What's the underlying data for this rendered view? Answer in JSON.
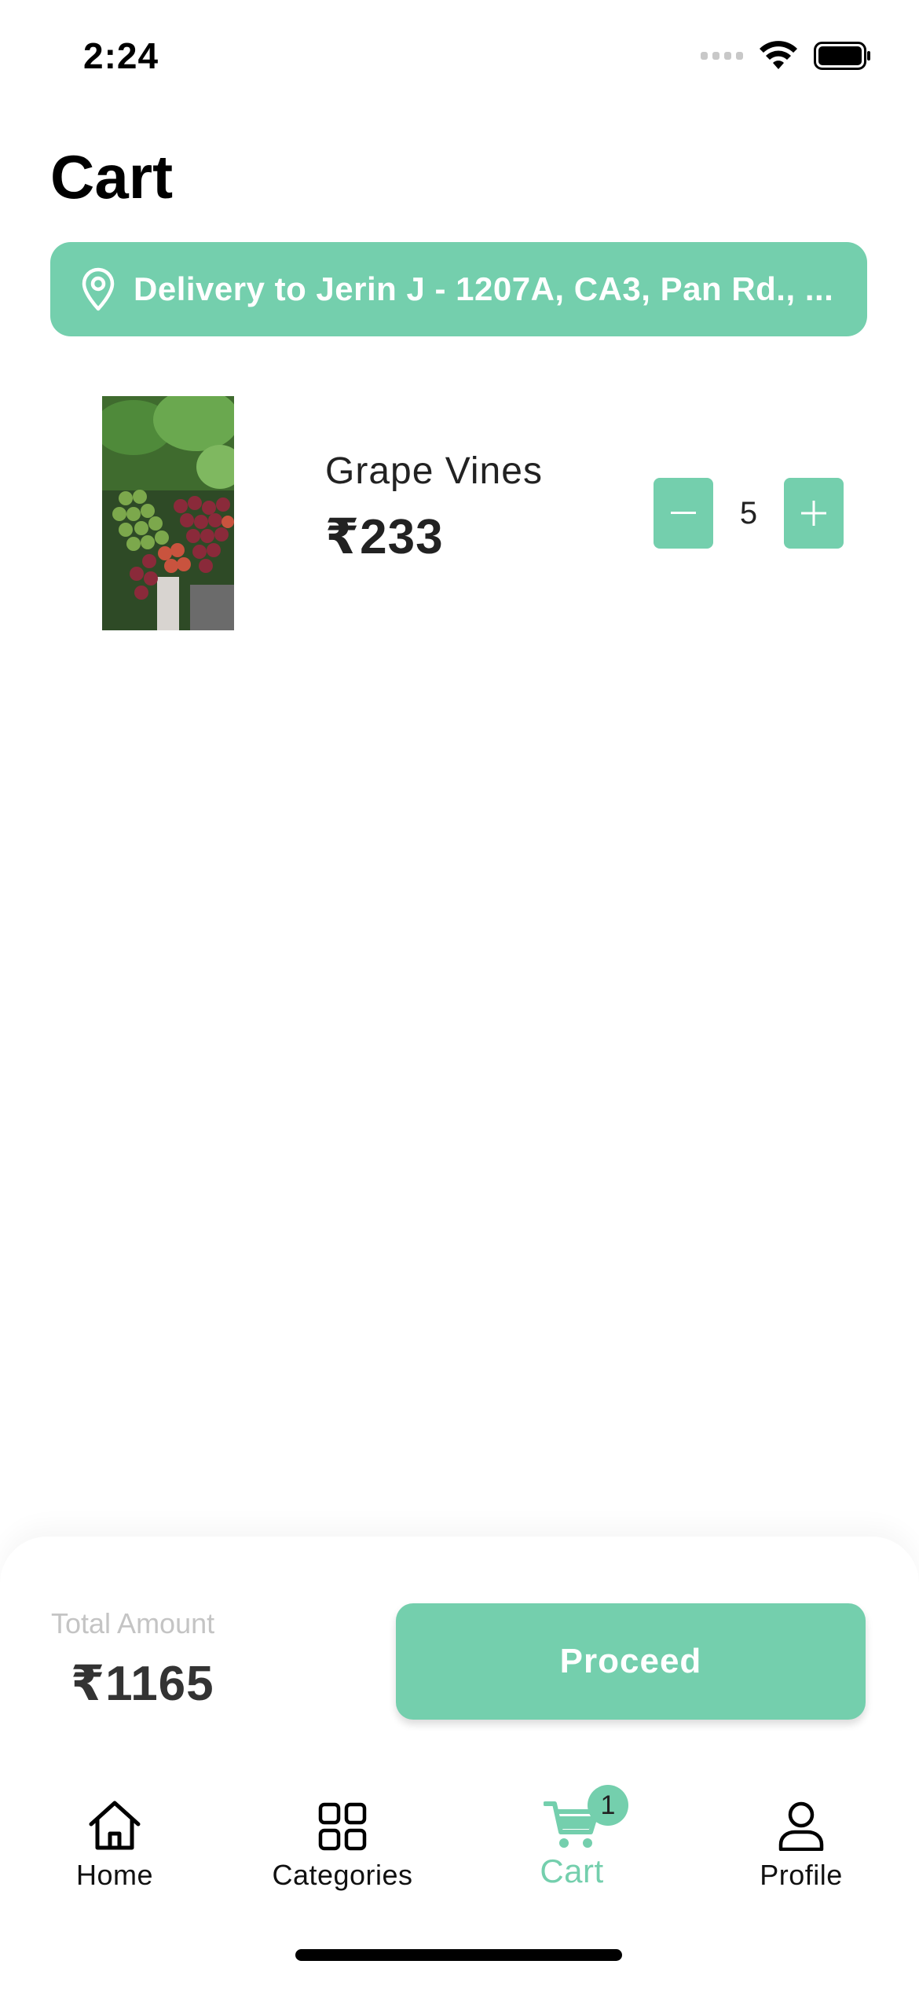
{
  "status_bar": {
    "time": "2:24",
    "icons": [
      "signal-dots-icon",
      "wifi-icon",
      "battery-icon"
    ]
  },
  "page": {
    "title": "Cart"
  },
  "delivery": {
    "icon": "location-pin-icon",
    "text": "Delivery to Jerin J - 1207A, CA3, Pan Rd., ..."
  },
  "cart_items": [
    {
      "name": "Grape Vines",
      "price": "₹233",
      "quantity": "5",
      "image": "grape-vines-photo"
    }
  ],
  "summary": {
    "total_label": "Total Amount",
    "total_value": "₹1165",
    "proceed_label": "Proceed"
  },
  "nav": {
    "items": [
      {
        "label": "Home",
        "icon": "home-icon"
      },
      {
        "label": "Categories",
        "icon": "grid-icon"
      },
      {
        "label": "Cart",
        "icon": "cart-icon",
        "badge": "1",
        "active": true
      },
      {
        "label": "Profile",
        "icon": "user-icon"
      }
    ]
  },
  "colors": {
    "accent": "#74cfad",
    "text": "#222222",
    "muted": "#c4c4c4"
  }
}
